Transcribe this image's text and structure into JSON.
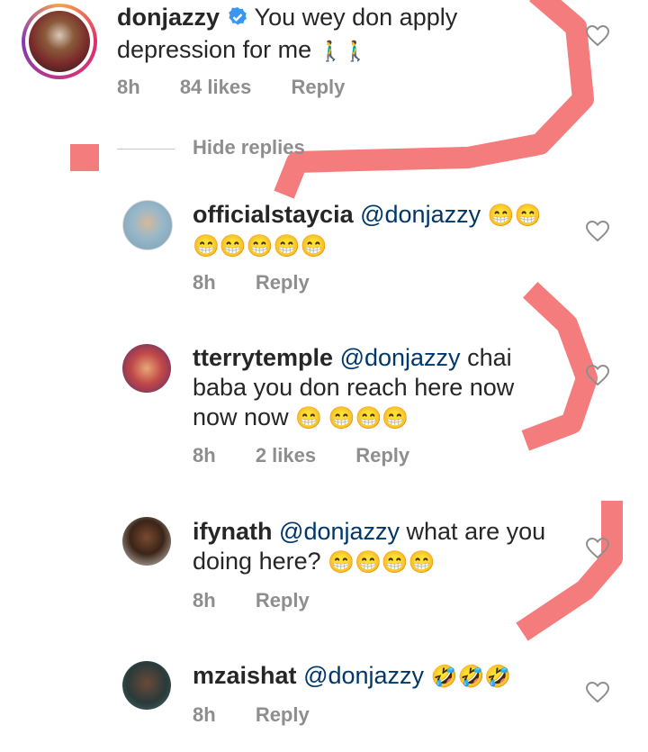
{
  "comments": [
    {
      "username": "donjazzy",
      "verified": true,
      "mention": "",
      "text_line1": "You wey don apply",
      "text_line2": "depression for me",
      "text_line3": "",
      "emoji_line1": "",
      "emoji_line2": "🚶‍♂️🚶‍♂️",
      "time": "8h",
      "likes": "84 likes",
      "reply": "Reply"
    },
    {
      "username": "officialstaycia",
      "mention": "@donjazzy",
      "text_line1": "",
      "text_line2": "",
      "text_line3": "",
      "emoji_line1": "😁😁",
      "emoji_line2": "😁😁😁😁😁",
      "time": "8h",
      "likes": "",
      "reply": "Reply"
    },
    {
      "username": "tterrytemple",
      "mention": "@donjazzy",
      "text_line1": "chai",
      "text_line2": "baba you don reach here now",
      "text_line3": "now now",
      "emoji_line3": "😁 😁😁😁",
      "time": "8h",
      "likes": "2 likes",
      "reply": "Reply"
    },
    {
      "username": "ifynath",
      "mention": "@donjazzy",
      "text_line1": "what are you",
      "text_line2": "doing here?",
      "emoji_line2": "😁😁😁😁",
      "time": "8h",
      "likes": "",
      "reply": "Reply"
    },
    {
      "username": "mzaishat",
      "mention": "@donjazzy",
      "emoji_line1": "🤣🤣🤣",
      "time": "8h",
      "likes": "",
      "reply": "Reply"
    }
  ],
  "hide_replies": "Hide replies",
  "icons": {
    "heart": "heart-outline-icon",
    "verified": "verified-badge-icon",
    "emoji_grin": "grinning-face-icon",
    "emoji_rofl": "rofl-face-icon",
    "emoji_walk": "man-walking-icon"
  },
  "colors": {
    "annotation": "#f47c7c",
    "mention": "#00376b",
    "meta": "#8e8e8e",
    "verified": "#3897f0"
  }
}
